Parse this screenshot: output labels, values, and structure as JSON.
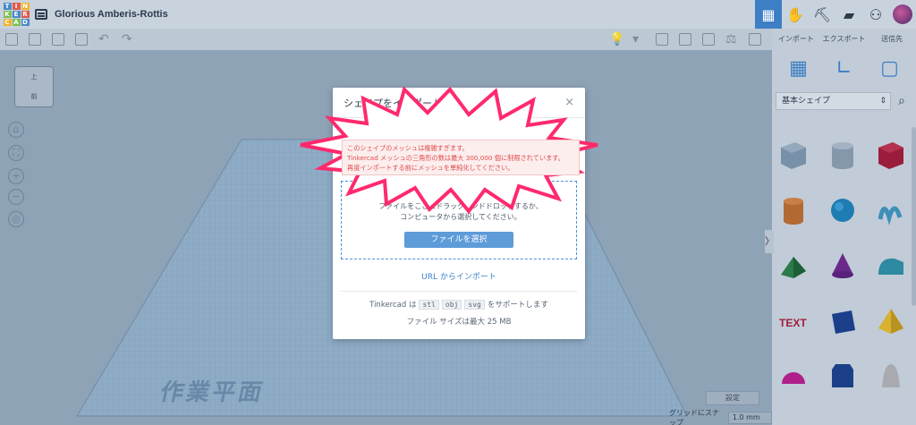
{
  "app": {
    "logo_letters": [
      "T",
      "I",
      "N",
      "K",
      "E",
      "R",
      "C",
      "A",
      "D"
    ],
    "title": "Glorious Amberis-Rottis"
  },
  "header_icons": [
    "grid-view-icon",
    "gallery-icon",
    "pickaxe-icon",
    "bricks-icon",
    "add-user-icon"
  ],
  "right_panel": {
    "tabs": [
      "インポート",
      "エクスポート",
      "送信先"
    ],
    "category": "基本シェイプ",
    "tools": [
      "workplane-icon",
      "ruler-icon",
      "notes-icon"
    ]
  },
  "canvas": {
    "viewcube_top": "上",
    "viewcube_front": "前",
    "workplane_label": "作業平面",
    "settings_label": "設定",
    "snap_label": "グリッドにスナップ",
    "snap_value": "1.0 mm"
  },
  "modal": {
    "title": "シェイプをインポート",
    "close": "×",
    "drop_text_1": "ファイルをここにドラッグアンドドロップするか、",
    "drop_text_2": "コンピュータから選択してください。",
    "select_button": "ファイルを選択",
    "url_import": "URL からインポート",
    "support_prefix": "Tinkercad は",
    "formats": [
      "stl",
      "obj",
      "svg"
    ],
    "support_suffix": "をサポートします",
    "file_size": "ファイル サイズは最大 25 MB"
  },
  "error": {
    "line1": "このシェイプのメッシュは複雑すぎます。",
    "line2": "Tinkercad メッシュの三角形の数は最大 300,000 個に制限されています。",
    "line3": "再度インポートする前にメッシュを単純化してください。"
  },
  "colors": {
    "accent": "#3d7fc4",
    "error": "#e04c4c",
    "burst": "#ff2a6d"
  }
}
